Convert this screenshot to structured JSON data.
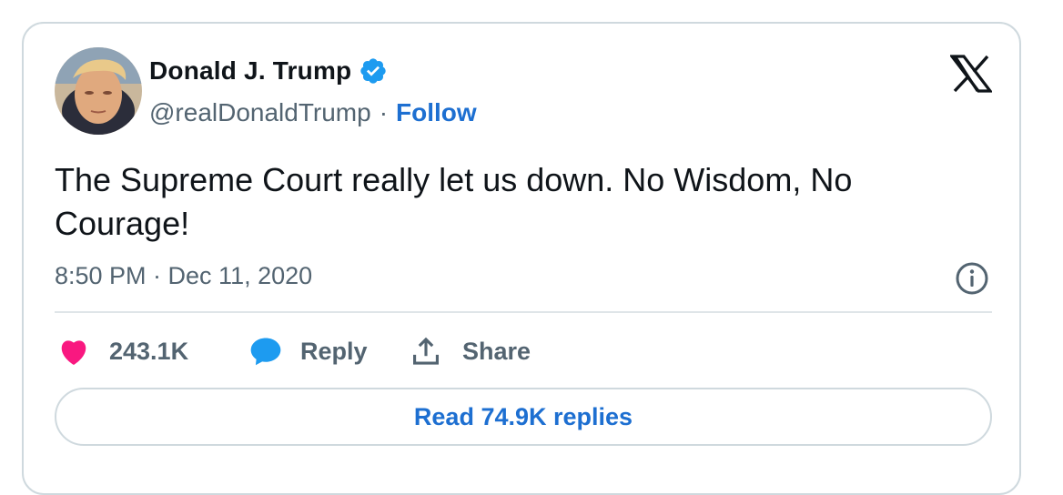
{
  "author": {
    "display_name": "Donald J. Trump",
    "handle": "@realDonaldTrump",
    "separator": "·",
    "follow_label": "Follow",
    "verified": true
  },
  "tweet": {
    "text": "The Supreme Court really let us down. No Wisdom, No Courage!",
    "timestamp": "8:50 PM · Dec 11, 2020"
  },
  "actions": {
    "like_count": "243.1K",
    "reply_label": "Reply",
    "share_label": "Share"
  },
  "read_replies_label": "Read 74.9K replies",
  "icons": {
    "brand": "x-logo-icon",
    "verified": "verified-badge-icon",
    "info": "info-icon",
    "like": "heart-icon",
    "reply": "speech-bubble-icon",
    "share": "share-upload-icon"
  },
  "colors": {
    "link_blue": "#1d6fd1",
    "verified_blue": "#1d9bf0",
    "heart_pink": "#f91880",
    "text": "#0f1419",
    "muted": "#536471",
    "border": "#cfd9de"
  }
}
